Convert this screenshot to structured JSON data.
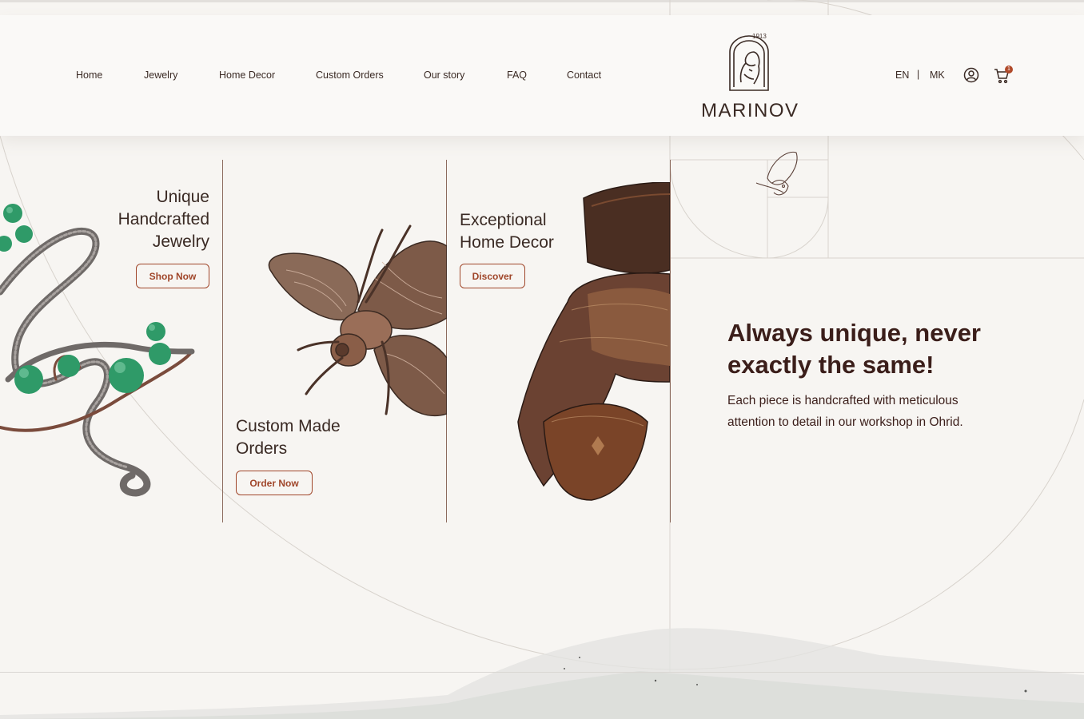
{
  "nav": {
    "items": [
      "Home",
      "Jewelry",
      "Home Decor",
      "Custom Orders",
      "Our story",
      "FAQ",
      "Contact"
    ]
  },
  "logo": {
    "year": "1913",
    "name": "MARINOV"
  },
  "lang": {
    "en": "EN",
    "separator": "|",
    "mk": "MK"
  },
  "cart": {
    "count": "1"
  },
  "panels": {
    "jewelry": {
      "title_lines": [
        "Unique",
        "Handcrafted",
        "Jewelry"
      ],
      "button": "Shop Now"
    },
    "custom": {
      "title_lines": [
        "Custom Made",
        "Orders"
      ],
      "button": "Order Now"
    },
    "decor": {
      "title_lines": [
        "Exceptional",
        "Home Decor"
      ],
      "button": "Discover"
    }
  },
  "hero": {
    "headline": "Always unique, never exactly the same!",
    "subtext": "Each piece is handcrafted with meticulous attention to detail in our workshop in Ohrid."
  },
  "colors": {
    "accent": "#a0462a",
    "text_dark": "#3b1e1a",
    "background": "#f7f5f2"
  },
  "icons": [
    "user-icon",
    "cart-icon",
    "butterfly-icon",
    "logo-portrait-icon"
  ]
}
